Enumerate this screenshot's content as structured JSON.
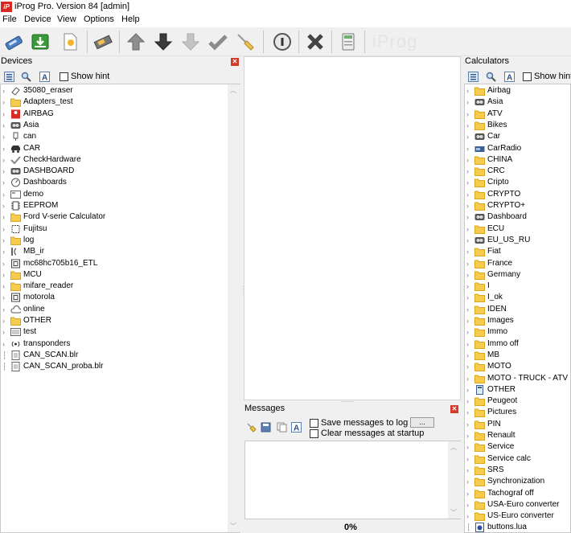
{
  "window": {
    "title": "iProg Pro. Version 84 [admin]",
    "app_icon_text": "iP"
  },
  "menu": [
    "File",
    "Device",
    "View",
    "Options",
    "Help"
  ],
  "toolbar": {
    "buttons": [
      "connect-icon",
      "download-icon",
      "new-file-icon",
      "chip-icon",
      "arrow-up-icon",
      "arrow-down-icon",
      "arrow-down-disabled-icon",
      "checkmark-icon",
      "broom-icon",
      "info-icon",
      "cross-icon",
      "calculator-icon"
    ],
    "ghost_text": "iProg"
  },
  "devices": {
    "title": "Devices",
    "show_hint": "Show hint",
    "items": [
      {
        "label": "35080_eraser",
        "icon": "eraser-icon",
        "expandable": true
      },
      {
        "label": "Adapters_test",
        "icon": "folder-icon",
        "expandable": true
      },
      {
        "label": "AIRBAG",
        "icon": "airbag-icon",
        "expandable": true
      },
      {
        "label": "Asia",
        "icon": "dashboard-icon",
        "expandable": true
      },
      {
        "label": "can",
        "icon": "plug-icon",
        "expandable": true
      },
      {
        "label": "CAR",
        "icon": "car-icon",
        "expandable": true
      },
      {
        "label": "CheckHardware",
        "icon": "check-hardware-icon",
        "expandable": true
      },
      {
        "label": "DASHBOARD",
        "icon": "dashboard-icon",
        "expandable": true
      },
      {
        "label": "Dashboards",
        "icon": "gauge-icon",
        "expandable": true
      },
      {
        "label": "demo",
        "icon": "demo-icon",
        "expandable": true
      },
      {
        "label": "EEPROM",
        "icon": "eeprom-icon",
        "expandable": true
      },
      {
        "label": "Ford V-serie Calculator",
        "icon": "folder-icon",
        "expandable": true
      },
      {
        "label": "Fujitsu",
        "icon": "chip-icon",
        "expandable": true
      },
      {
        "label": "log",
        "icon": "folder-icon",
        "expandable": true
      },
      {
        "label": "MB_ir",
        "icon": "infrared-icon",
        "expandable": true
      },
      {
        "label": "mc68hc705b16_ETL",
        "icon": "mcu-icon",
        "expandable": true
      },
      {
        "label": "MCU",
        "icon": "folder-icon",
        "expandable": true
      },
      {
        "label": "mifare_reader",
        "icon": "folder-icon",
        "expandable": true
      },
      {
        "label": "motorola",
        "icon": "mcu-icon",
        "expandable": true
      },
      {
        "label": "online",
        "icon": "cloud-icon",
        "expandable": true
      },
      {
        "label": "OTHER",
        "icon": "folder-icon",
        "expandable": true
      },
      {
        "label": "test",
        "icon": "test-icon",
        "expandable": true
      },
      {
        "label": "transponders",
        "icon": "transponder-icon",
        "expandable": true
      },
      {
        "label": "CAN_SCAN.blr",
        "icon": "file-icon",
        "expandable": false
      },
      {
        "label": "CAN_SCAN_proba.blr",
        "icon": "file-icon",
        "expandable": false
      }
    ]
  },
  "messages": {
    "title": "Messages",
    "save_to_log": "Save messages to log fi",
    "browse": "...",
    "clear_at_startup": "Clear messages at startup",
    "progress": "0%"
  },
  "calculators": {
    "title": "Calculators",
    "show_hint": "Show hint",
    "items": [
      {
        "label": "Airbag",
        "icon": "folder-icon"
      },
      {
        "label": "Asia",
        "icon": "dashboard-icon"
      },
      {
        "label": "ATV",
        "icon": "folder-icon"
      },
      {
        "label": "Bikes",
        "icon": "folder-icon"
      },
      {
        "label": "Car",
        "icon": "dashboard-icon"
      },
      {
        "label": "CarRadio",
        "icon": "radio-icon"
      },
      {
        "label": "CHINA",
        "icon": "folder-icon"
      },
      {
        "label": "CRC",
        "icon": "folder-icon"
      },
      {
        "label": "Cripto",
        "icon": "folder-icon"
      },
      {
        "label": "CRYPTO",
        "icon": "folder-icon"
      },
      {
        "label": "CRYPTO+",
        "icon": "folder-icon"
      },
      {
        "label": "Dashboard",
        "icon": "dashboard-icon"
      },
      {
        "label": "ECU",
        "icon": "folder-icon"
      },
      {
        "label": "EU_US_RU",
        "icon": "dashboard-icon"
      },
      {
        "label": "Fiat",
        "icon": "folder-icon"
      },
      {
        "label": "France",
        "icon": "folder-icon"
      },
      {
        "label": "Germany",
        "icon": "folder-icon"
      },
      {
        "label": "I",
        "icon": "folder-icon"
      },
      {
        "label": "I_ok",
        "icon": "folder-icon"
      },
      {
        "label": "IDEN",
        "icon": "folder-icon"
      },
      {
        "label": "Images",
        "icon": "folder-icon"
      },
      {
        "label": "Immo",
        "icon": "folder-icon"
      },
      {
        "label": "Immo off",
        "icon": "folder-icon"
      },
      {
        "label": "MB",
        "icon": "folder-icon"
      },
      {
        "label": "MOTO",
        "icon": "folder-icon"
      },
      {
        "label": "MOTO - TRUCK - ATV",
        "icon": "folder-icon"
      },
      {
        "label": "OTHER",
        "icon": "calculator-icon"
      },
      {
        "label": "Peugeot",
        "icon": "folder-icon"
      },
      {
        "label": "Pictures",
        "icon": "folder-icon"
      },
      {
        "label": "PIN",
        "icon": "folder-icon"
      },
      {
        "label": "Renault",
        "icon": "folder-icon"
      },
      {
        "label": "Service",
        "icon": "folder-icon"
      },
      {
        "label": "Service calc",
        "icon": "folder-icon"
      },
      {
        "label": "SRS",
        "icon": "folder-icon"
      },
      {
        "label": "Synchronization",
        "icon": "folder-icon"
      },
      {
        "label": "Tachograf off",
        "icon": "folder-icon"
      },
      {
        "label": "USA-Euro converter",
        "icon": "folder-icon"
      },
      {
        "label": "US-Euro converter",
        "icon": "folder-icon"
      },
      {
        "label": "buttons.lua",
        "icon": "lua-file-icon"
      }
    ]
  }
}
